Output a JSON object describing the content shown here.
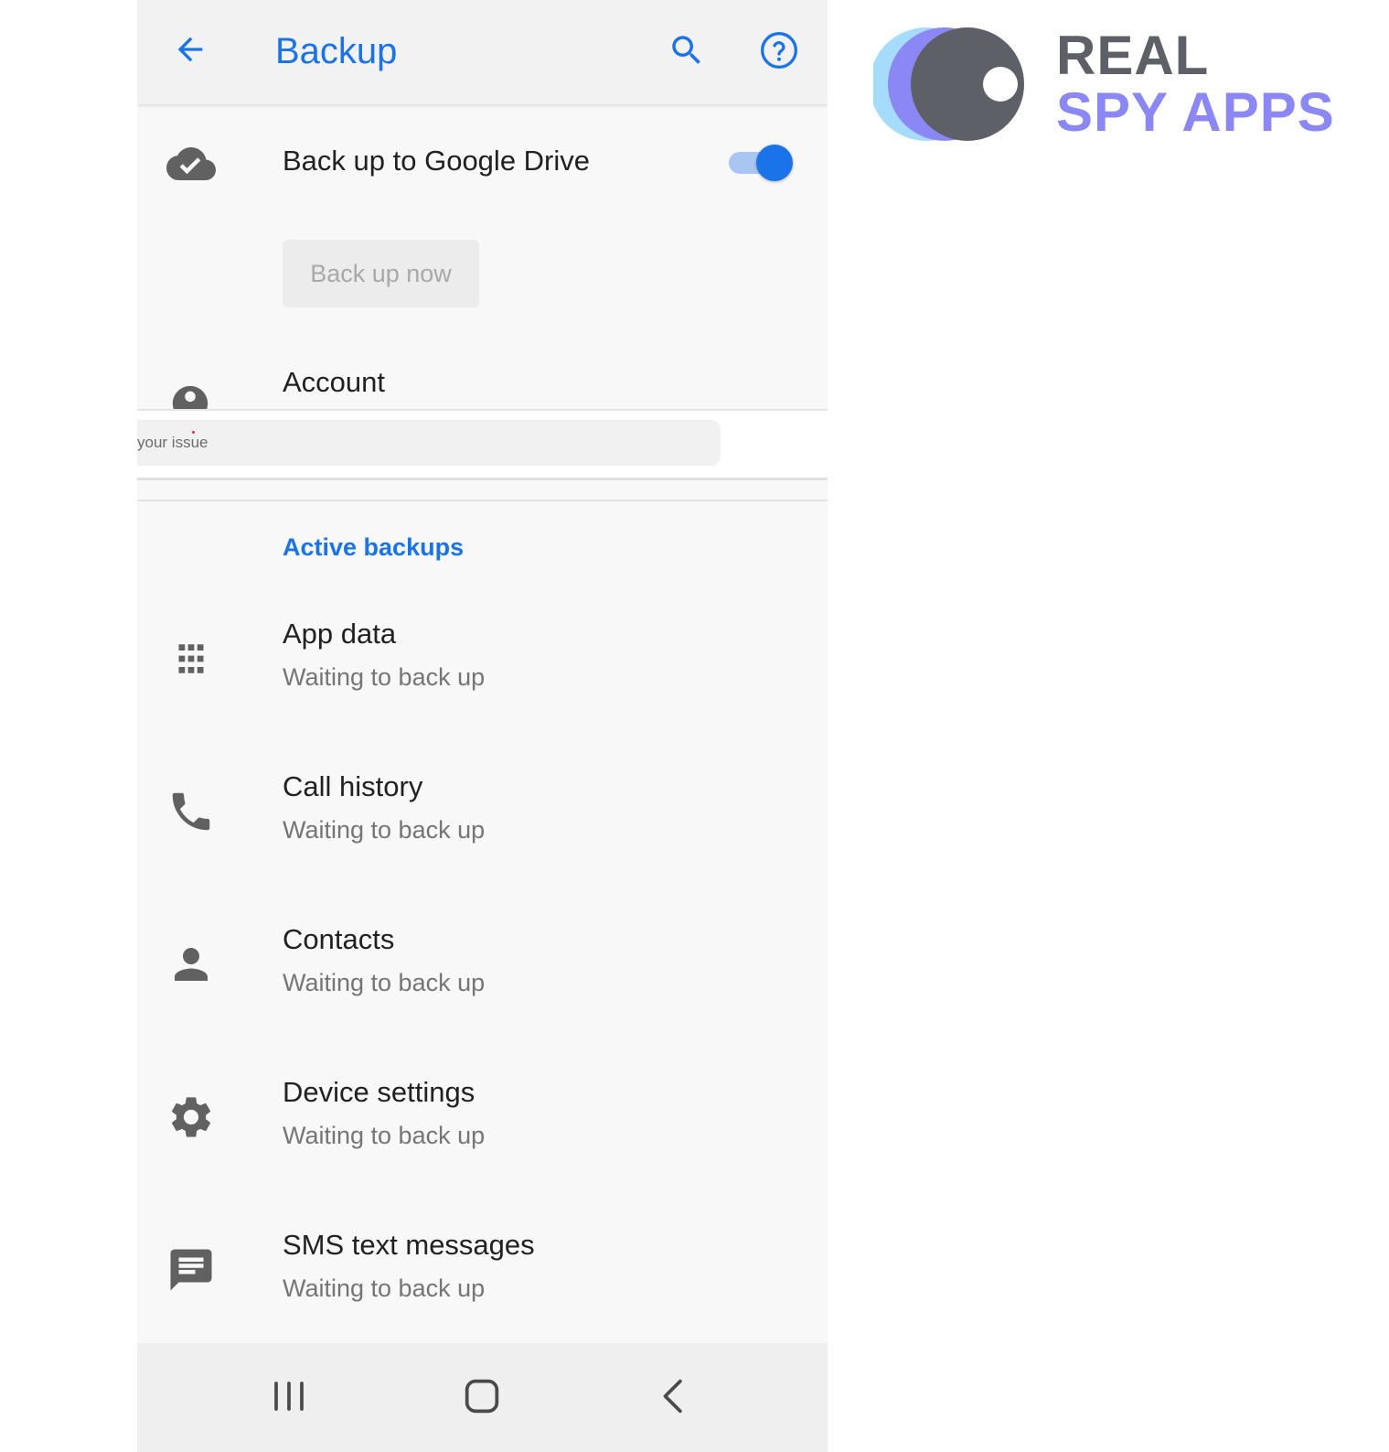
{
  "appbar": {
    "title": "Backup",
    "back_icon": "arrow-left-icon",
    "search_icon": "search-icon",
    "help_icon": "help-circle-icon"
  },
  "drive_backup": {
    "label": "Back up to Google Drive",
    "icon": "cloud-check-icon",
    "toggle_on": true,
    "backup_now_label": "Back up now"
  },
  "account": {
    "label": "Account",
    "icon": "account-circle-icon"
  },
  "overlay_field": {
    "text": "your issue"
  },
  "active_backups": {
    "header": "Active backups",
    "items": [
      {
        "title": "App data",
        "status": "Waiting to back up",
        "icon": "apps-grid-icon"
      },
      {
        "title": "Call history",
        "status": "Waiting to back up",
        "icon": "phone-icon"
      },
      {
        "title": "Contacts",
        "status": "Waiting to back up",
        "icon": "person-icon"
      },
      {
        "title": "Device settings",
        "status": "Waiting to back up",
        "icon": "gear-icon"
      },
      {
        "title": "SMS text messages",
        "status": "Waiting to back up",
        "icon": "message-icon"
      }
    ]
  },
  "navbar": {
    "recents_icon": "recents-icon",
    "home_icon": "home-icon",
    "back_icon": "nav-back-icon"
  },
  "brand": {
    "line1": "REAL",
    "line2": "SPY APPS",
    "color_dark": "#5d6066",
    "color_accent": "#8b88f5",
    "color_light": "#a6dcfb"
  },
  "colors": {
    "accent": "#1a73e8",
    "icon_gray": "#616161"
  }
}
